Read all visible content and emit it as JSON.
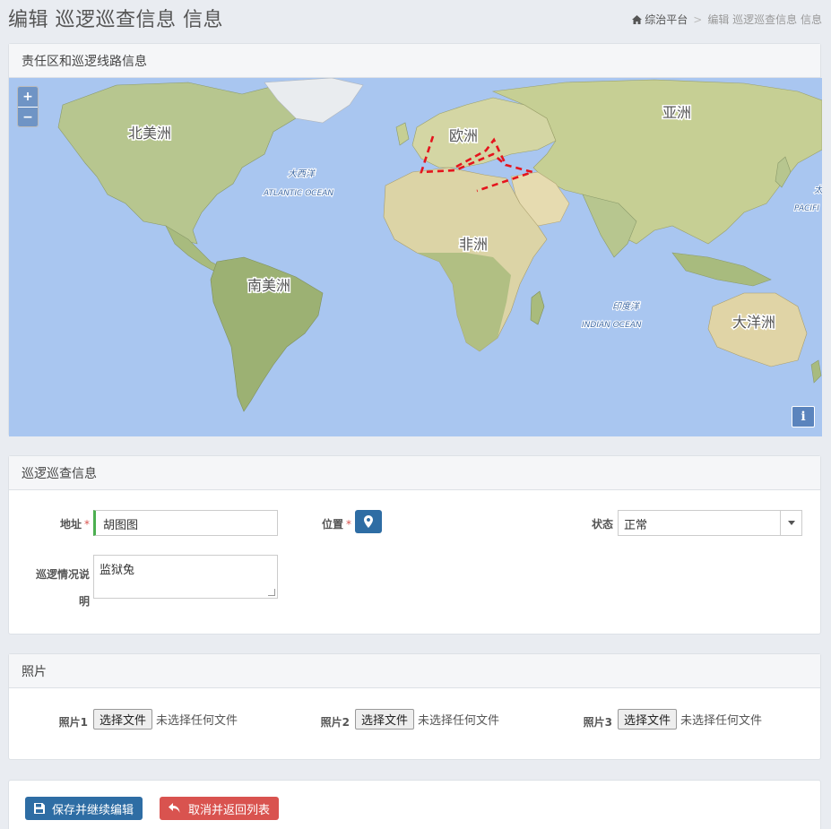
{
  "header": {
    "title": "编辑 巡逻巡查信息 信息",
    "breadcrumb_home": "综治平台",
    "breadcrumb_sep": ">",
    "breadcrumb_current": "编辑 巡逻巡查信息 信息"
  },
  "map_panel": {
    "title": "责任区和巡逻线路信息",
    "zoom_in": "+",
    "zoom_out": "−",
    "info": "i",
    "labels": {
      "north_america": "北美洲",
      "south_america": "南美洲",
      "europe": "欧洲",
      "africa": "非洲",
      "asia": "亚洲",
      "oceania": "大洋洲",
      "atlantic_cn": "大西洋",
      "atlantic_en": "ATLANTIC OCEAN",
      "indian_cn": "印度洋",
      "indian_en": "INDIAN OCEAN",
      "pacific_cn": "太",
      "pacific_en": "PACIFI"
    }
  },
  "patrol_panel": {
    "title": "巡逻巡查信息",
    "address_label": "地址",
    "address_value": "胡图图",
    "location_label": "位置",
    "status_label": "状态",
    "status_value": "正常",
    "notes_label_1": "巡逻情况说",
    "notes_label_2": "明",
    "notes_value": "监狱兔",
    "required_mark": "*"
  },
  "photos_panel": {
    "title": "照片",
    "items": [
      {
        "label": "照片1",
        "button": "选择文件",
        "status": "未选择任何文件"
      },
      {
        "label": "照片2",
        "button": "选择文件",
        "status": "未选择任何文件"
      },
      {
        "label": "照片3",
        "button": "选择文件",
        "status": "未选择任何文件"
      }
    ]
  },
  "actions": {
    "save_label": "保存并继续编辑",
    "cancel_label": "取消并返回列表"
  },
  "colors": {
    "primary": "#2e6da4",
    "danger": "#d9534f",
    "valid": "#4caf50",
    "ocean": "#a9c6f0",
    "route": "#e5141d"
  }
}
